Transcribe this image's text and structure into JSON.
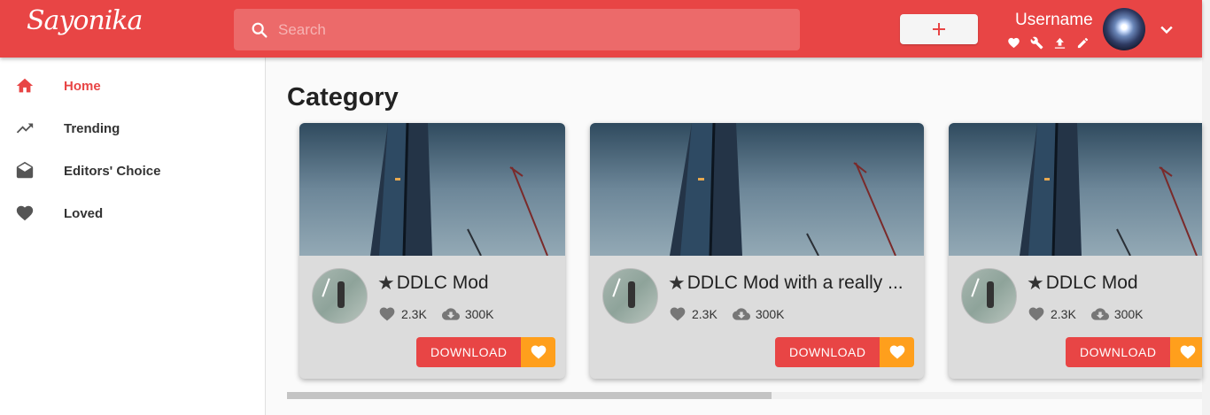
{
  "header": {
    "logo": "Sayonika",
    "search_placeholder": "Search",
    "add_button_label": "+",
    "username": "Username",
    "user_icons": [
      "heart-icon",
      "wrench-icon",
      "upload-icon",
      "pencil-icon"
    ]
  },
  "sidebar": {
    "items": [
      {
        "label": "Home",
        "icon": "home-icon",
        "active": true
      },
      {
        "label": "Trending",
        "icon": "trending-icon",
        "active": false
      },
      {
        "label": "Editors' Choice",
        "icon": "drafts-icon",
        "active": false
      },
      {
        "label": "Loved",
        "icon": "heart-icon",
        "active": false
      }
    ]
  },
  "main": {
    "category_title": "Category",
    "cards": [
      {
        "title": "DDLC Mod",
        "likes": "2.3K",
        "downloads": "300K",
        "download_label": "DOWNLOAD"
      },
      {
        "title": "DDLC Mod with a really ...",
        "likes": "2.3K",
        "downloads": "300K",
        "download_label": "DOWNLOAD"
      },
      {
        "title": "DDLC Mod",
        "likes": "2.3K",
        "downloads": "300K",
        "download_label": "DOWNLOAD"
      }
    ]
  },
  "colors": {
    "brand": "#e84545",
    "accent": "#ff9f1c"
  }
}
